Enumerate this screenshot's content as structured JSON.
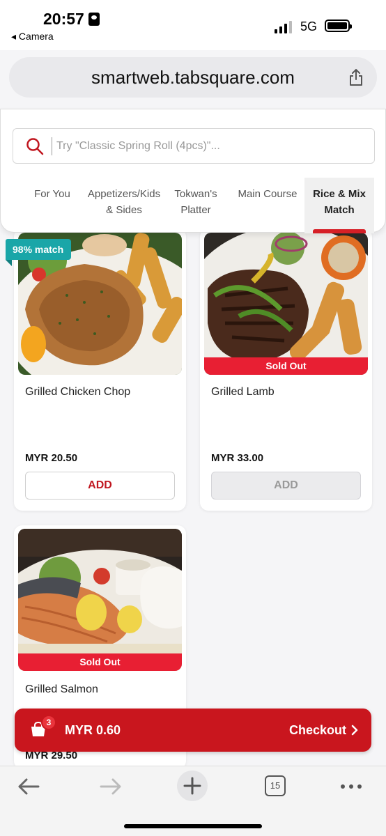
{
  "status_bar": {
    "time": "20:57",
    "back_app": "◂ Camera",
    "network": "5G"
  },
  "browser": {
    "url": "smartweb.tabsquare.com",
    "tab_count": "15"
  },
  "search": {
    "placeholder": "Try \"Classic Spring Roll (4pcs)\"..."
  },
  "tabs": [
    {
      "label": "For You",
      "active": false
    },
    {
      "label": "Appetizers/Kids & Sides",
      "active": false
    },
    {
      "label": "Tokwan's Platter",
      "active": false
    },
    {
      "label": "Main Course",
      "active": false
    },
    {
      "label": "Rice & Mix Match",
      "active": true
    }
  ],
  "items": [
    {
      "name": "Grilled Chicken Chop",
      "price": "MYR 20.50",
      "button": "ADD",
      "sold_out": false,
      "badge": "98% match"
    },
    {
      "name": "Grilled Lamb",
      "price": "MYR 33.00",
      "button": "ADD",
      "sold_out": true,
      "sold_out_label": "Sold Out"
    },
    {
      "name": "Grilled Salmon",
      "price": "MYR 29.50",
      "sold_out": true,
      "sold_out_label": "Sold Out"
    }
  ],
  "checkout": {
    "count": "3",
    "total": "MYR 0.60",
    "label": "Checkout"
  },
  "colors": {
    "brand_red": "#c9161e",
    "sold_out_red": "#e81f33",
    "match_teal": "#1aa6a8"
  }
}
